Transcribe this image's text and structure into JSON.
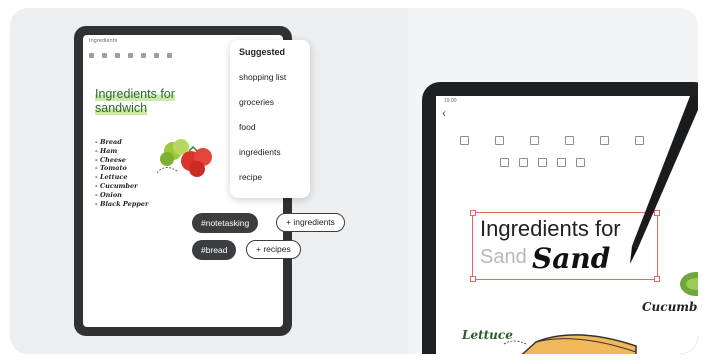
{
  "left_tablet": {
    "status_bar": "Ingredients",
    "note_title": "Ingredients for sandwich",
    "ingredients": [
      "Bread",
      "Ham",
      "Cheese",
      "Tomato",
      "Lettuce",
      "Cucumber",
      "Onion",
      "Black Pepper"
    ]
  },
  "suggestions": {
    "header": "Suggested",
    "items": [
      "shopping list",
      "groceries",
      "food",
      "ingredients",
      "recipe"
    ]
  },
  "tags": [
    {
      "label": "#notetasking"
    },
    {
      "label": "+ ingredients"
    },
    {
      "label": "#bread"
    },
    {
      "label": "+ recipes"
    }
  ],
  "right_tablet": {
    "status_time": "19:00",
    "back_icon": "back-arrow-icon",
    "typed_title_line1": "Ingredients for",
    "typed_title_line2": "Sand",
    "handwriting": "Sand",
    "label_cucumber": "Cucumber",
    "label_lettuce": "Lettuce"
  },
  "colors": {
    "title_green": "#2d6a34",
    "selection_red": "#e06a63",
    "chip_dark": "#3b3d40"
  }
}
